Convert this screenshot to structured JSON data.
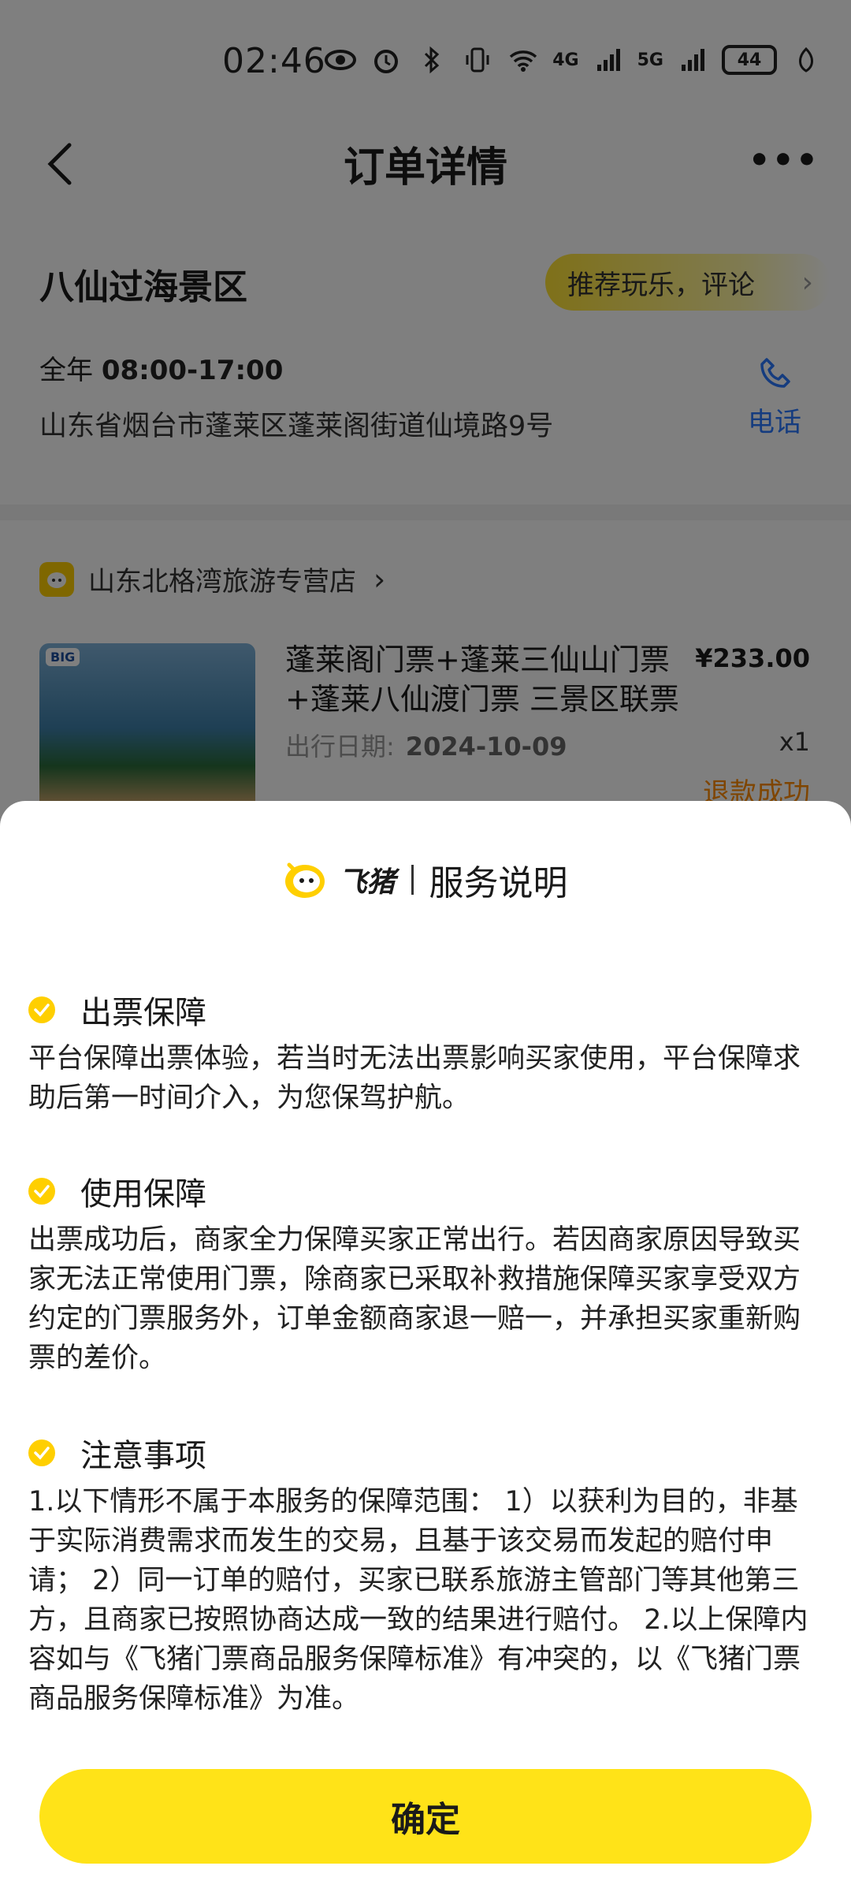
{
  "status_bar": {
    "time": "02:46",
    "signal_4g": "4G",
    "signal_5g": "5G",
    "battery": "44"
  },
  "nav": {
    "title": "订单详情",
    "more": "•••"
  },
  "scenic": {
    "name": "八仙过海景区",
    "recommend_label": "推荐玩乐，评论",
    "hours_prefix": "全年",
    "hours": "08:00-17:00",
    "address": "山东省烟台市蓬莱区蓬莱阁街道仙境路9号",
    "phone_label": "电话"
  },
  "order": {
    "shop_name": "山东北格湾旅游专营店",
    "thumb_badge": "BIG",
    "product_title": "蓬莱阁门票+蓬莱三仙山门票+蓬莱八仙渡门票 三景区联票",
    "price": "¥233.00",
    "date_label": "出行日期:",
    "date_value": "2024-10-09",
    "quantity": "x1",
    "status": "退款成功"
  },
  "sheet": {
    "brand": "飞猪",
    "title": "服务说明",
    "sections": [
      {
        "title": "出票保障",
        "body": "平台保障出票体验，若当时无法出票影响买家使用，平台保障求助后第一时间介入，为您保驾护航。"
      },
      {
        "title": "使用保障",
        "body": "出票成功后，商家全力保障买家正常出行。若因商家原因导致买家无法正常使用门票，除商家已采取补救措施保障买家享受双方约定的门票服务外，订单金额商家退一赔一，并承担买家重新购票的差价。"
      },
      {
        "title": "注意事项",
        "body": "1.以下情形不属于本服务的保障范围： 1）以获利为目的，非基于实际消费需求而发生的交易，且基于该交易而发起的赔付申请； 2）同一订单的赔付，买家已联系旅游主管部门等其他第三方，且商家已按照协商达成一致的结果进行赔付。 2.以上保障内容如与《飞猪门票商品服务保障标准》有冲突的，以《飞猪门票商品服务保障标准》为准。"
      }
    ],
    "confirm_label": "确定"
  },
  "colors": {
    "accent_yellow": "#ffe318",
    "check_yellow": "#ffcf00",
    "link_blue": "#2b78ff",
    "refund_orange": "#ff8a00"
  }
}
